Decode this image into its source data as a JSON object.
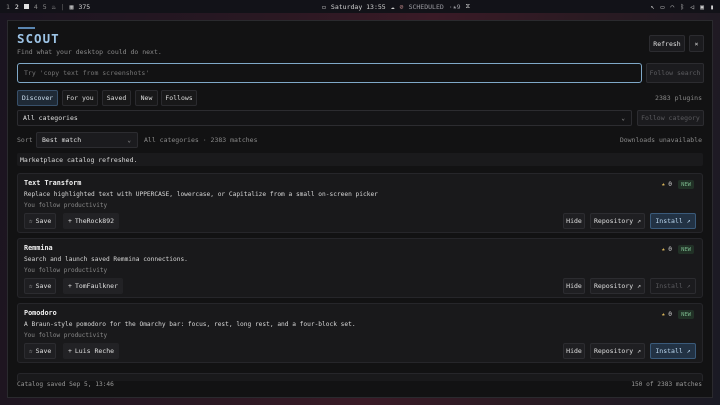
{
  "topbar": {
    "workspaces": [
      "1",
      "2",
      "3",
      "4",
      "5"
    ],
    "active_workspace": "2",
    "extra_count": "375",
    "clock": "Saturday 13:55",
    "scheduled": "SCHEDULED",
    "scheduled_count": "9"
  },
  "app": {
    "title": "SCOUT",
    "subtitle": "Find what your desktop could do next.",
    "refresh_label": "Refresh",
    "close_label": "×"
  },
  "search": {
    "placeholder": "Try 'copy text from screenshots'",
    "value": "",
    "follow_label": "Follow search"
  },
  "tabs": [
    {
      "label": "Discover",
      "active": true
    },
    {
      "label": "For you",
      "active": false
    },
    {
      "label": "Saved",
      "active": false
    },
    {
      "label": "New",
      "active": false
    },
    {
      "label": "Follows",
      "active": false
    }
  ],
  "plugin_count": "2383 plugins",
  "category": {
    "selected": "All categories",
    "follow_label": "Follow category"
  },
  "sort": {
    "label": "Sort",
    "selected": "Best match",
    "summary": "All categories · 2383 matches",
    "downloads": "Downloads unavailable"
  },
  "notice": "Marketplace catalog refreshed.",
  "cards": [
    {
      "name": "Text Transform",
      "description": "Replace highlighted text with UPPERCASE, lowercase, or Capitalize from a small on-screen picker",
      "follow": "You follow productivity",
      "rating": "0",
      "badge": "NEW",
      "save_label": "Save",
      "author": "TheRock892",
      "hide_label": "Hide",
      "repo_label": "Repository ↗",
      "install_label": "Install ↗",
      "install_enabled": true
    },
    {
      "name": "Remmina",
      "description": "Search and launch saved Remmina connections.",
      "follow": "You follow productivity",
      "rating": "0",
      "badge": "NEW",
      "save_label": "Save",
      "author": "TomFaulkner",
      "hide_label": "Hide",
      "repo_label": "Repository ↗",
      "install_label": "Install ↗",
      "install_enabled": false
    },
    {
      "name": "Pomodoro",
      "description": "A Braun-style pomodoro for the Omarchy bar: focus, rest, long rest, and a four-block set.",
      "follow": "You follow productivity",
      "rating": "0",
      "badge": "NEW",
      "save_label": "Save",
      "author": "Luis Reche",
      "hide_label": "Hide",
      "repo_label": "Repository ↗",
      "install_label": "Install ↗",
      "install_enabled": true
    }
  ],
  "footer": {
    "saved": "Catalog saved Sep 5, 13:46",
    "matches": "150 of 2383 matches"
  },
  "colors": {
    "accent": "#9dc4e6",
    "search_border": "#7fa8c8",
    "badge_bg": "#213126",
    "badge_text": "#78b48a",
    "star": "#d6b35a"
  }
}
